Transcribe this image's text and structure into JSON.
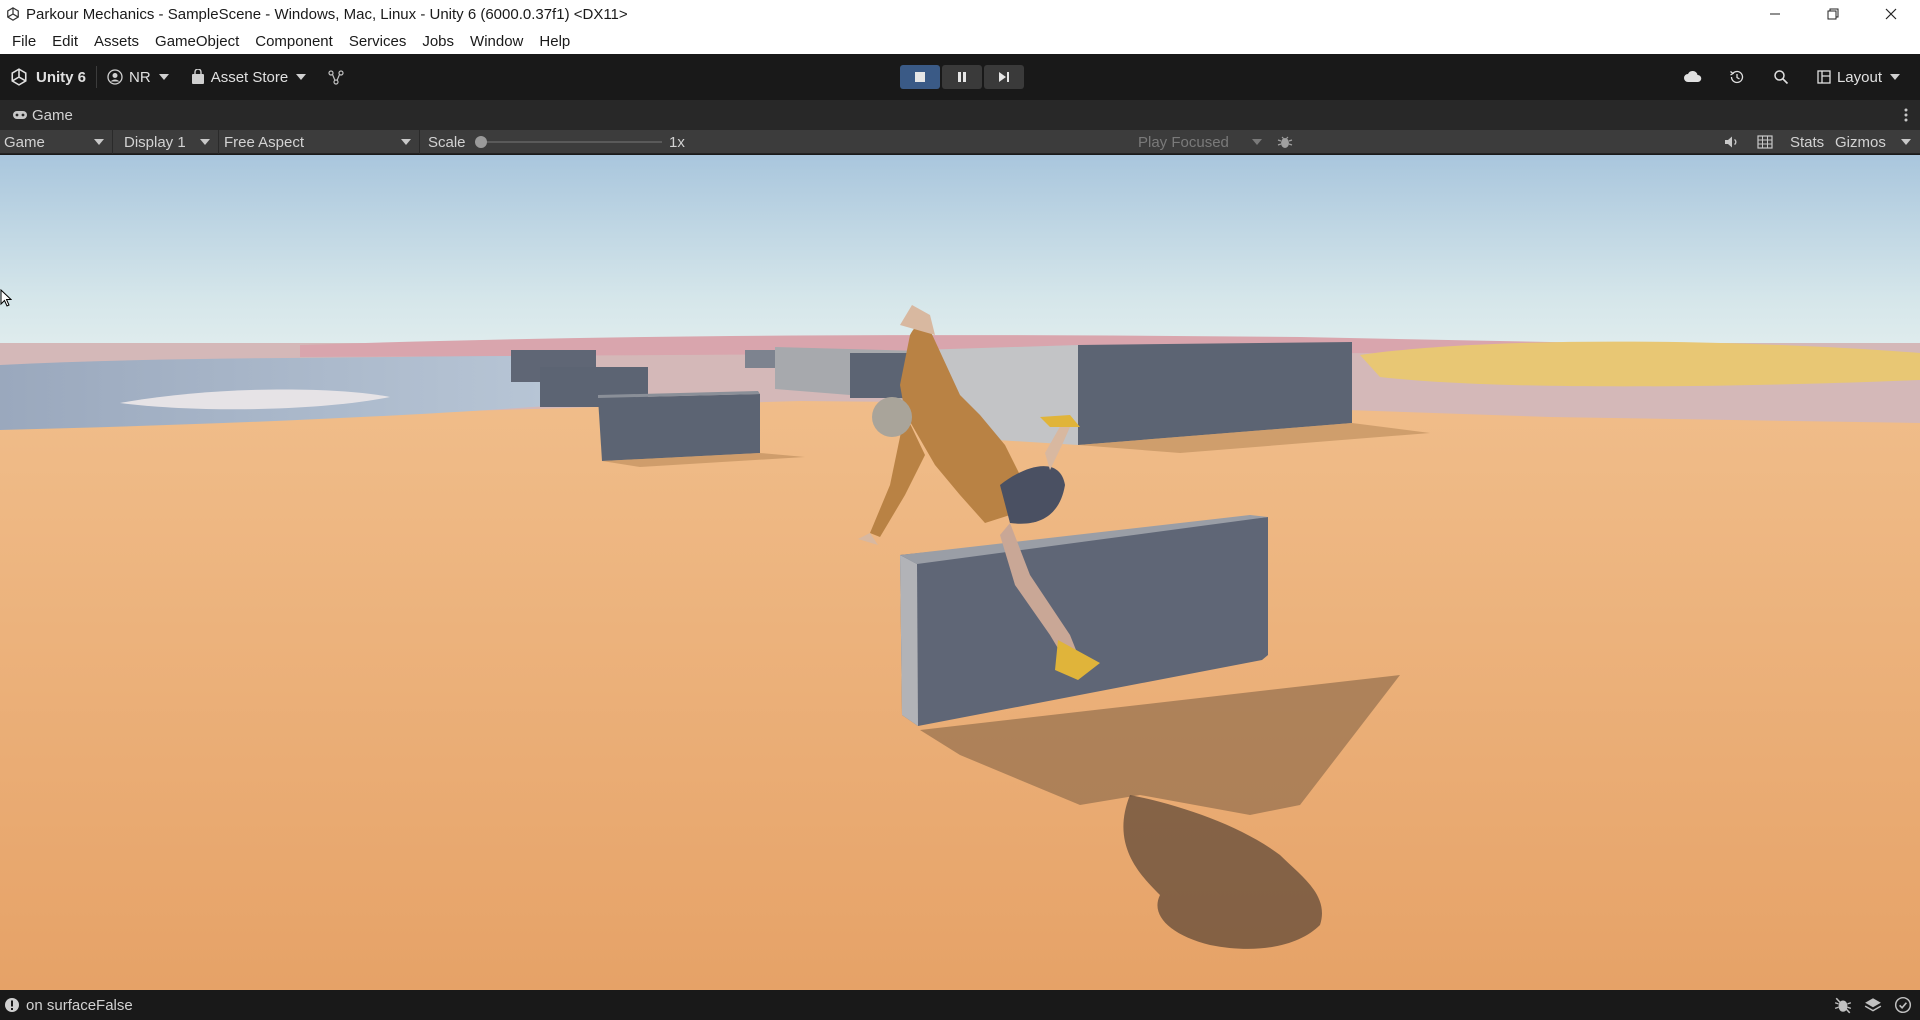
{
  "window": {
    "title": "Parkour Mechanics - SampleScene - Windows, Mac, Linux - Unity 6 (6000.0.37f1) <DX11>"
  },
  "menu": {
    "items": [
      "File",
      "Edit",
      "Assets",
      "GameObject",
      "Component",
      "Services",
      "Jobs",
      "Window",
      "Help"
    ]
  },
  "toolbar": {
    "unity_label": "Unity 6",
    "account_label": "NR",
    "asset_store_label": "Asset Store",
    "layout_label": "Layout"
  },
  "game_tab": {
    "label": "Game"
  },
  "game_toolbar": {
    "view_mode": "Game",
    "display": "Display 1",
    "aspect": "Free Aspect",
    "scale_label": "Scale",
    "scale_value": "1x",
    "play_mode": "Play Focused",
    "stats_label": "Stats",
    "gizmos_label": "Gizmos"
  },
  "status": {
    "message": "on surfaceFalse"
  },
  "colors": {
    "accent_play": "#3a5a86",
    "sand": "#e8a96b",
    "sky_top": "#a9c6dd",
    "block": "#5c6473"
  }
}
